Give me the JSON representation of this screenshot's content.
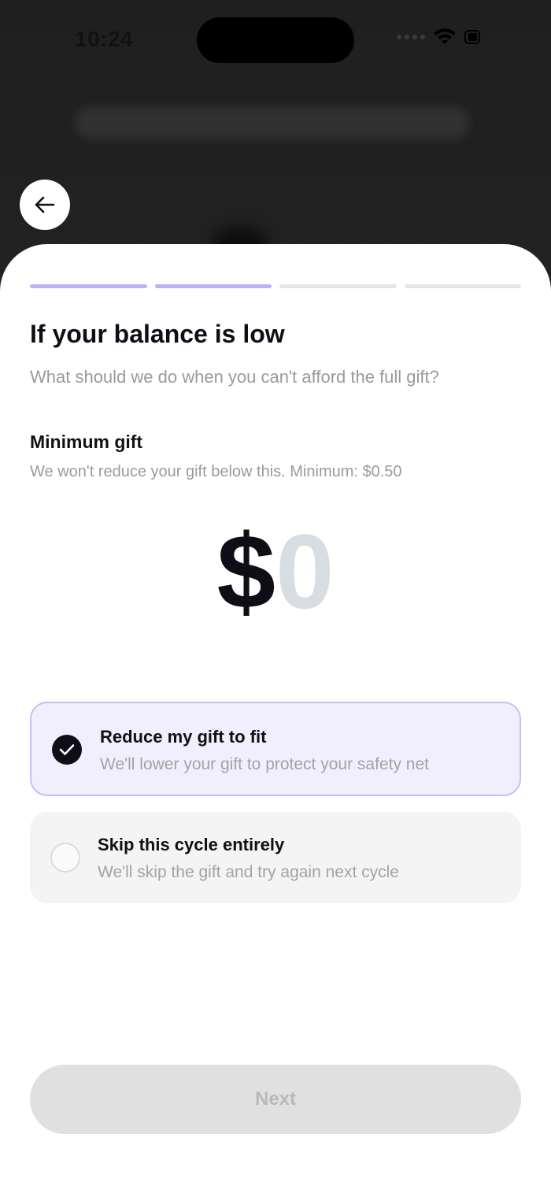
{
  "status_bar": {
    "time": "10:24"
  },
  "icons": {
    "back": "arrow-left-icon",
    "wifi": "wifi-icon",
    "battery": "battery-icon",
    "check": "checkmark-icon"
  },
  "sheet": {
    "progress": {
      "total_steps": 4,
      "completed_steps": 2
    },
    "title": "If your balance is low",
    "subtitle": "What should we do when you can't afford the full gift?",
    "minimum_gift": {
      "label": "Minimum gift",
      "help": "We won't reduce your gift below this. Minimum: $0.50",
      "currency_symbol": "$",
      "value": "0"
    },
    "options": [
      {
        "title": "Reduce my gift to fit",
        "description": "We'll lower your gift to protect your safety net",
        "selected": true
      },
      {
        "title": "Skip this cycle entirely",
        "description": "We'll skip the gift and try again next cycle",
        "selected": false
      }
    ],
    "next_label": "Next"
  },
  "colors": {
    "accent": "#bbb2f4",
    "selected_bg": "#f1effe",
    "text_dark": "#0e0e17",
    "muted": "#9a9a9a",
    "disabled_button": "#e0e0e0"
  }
}
